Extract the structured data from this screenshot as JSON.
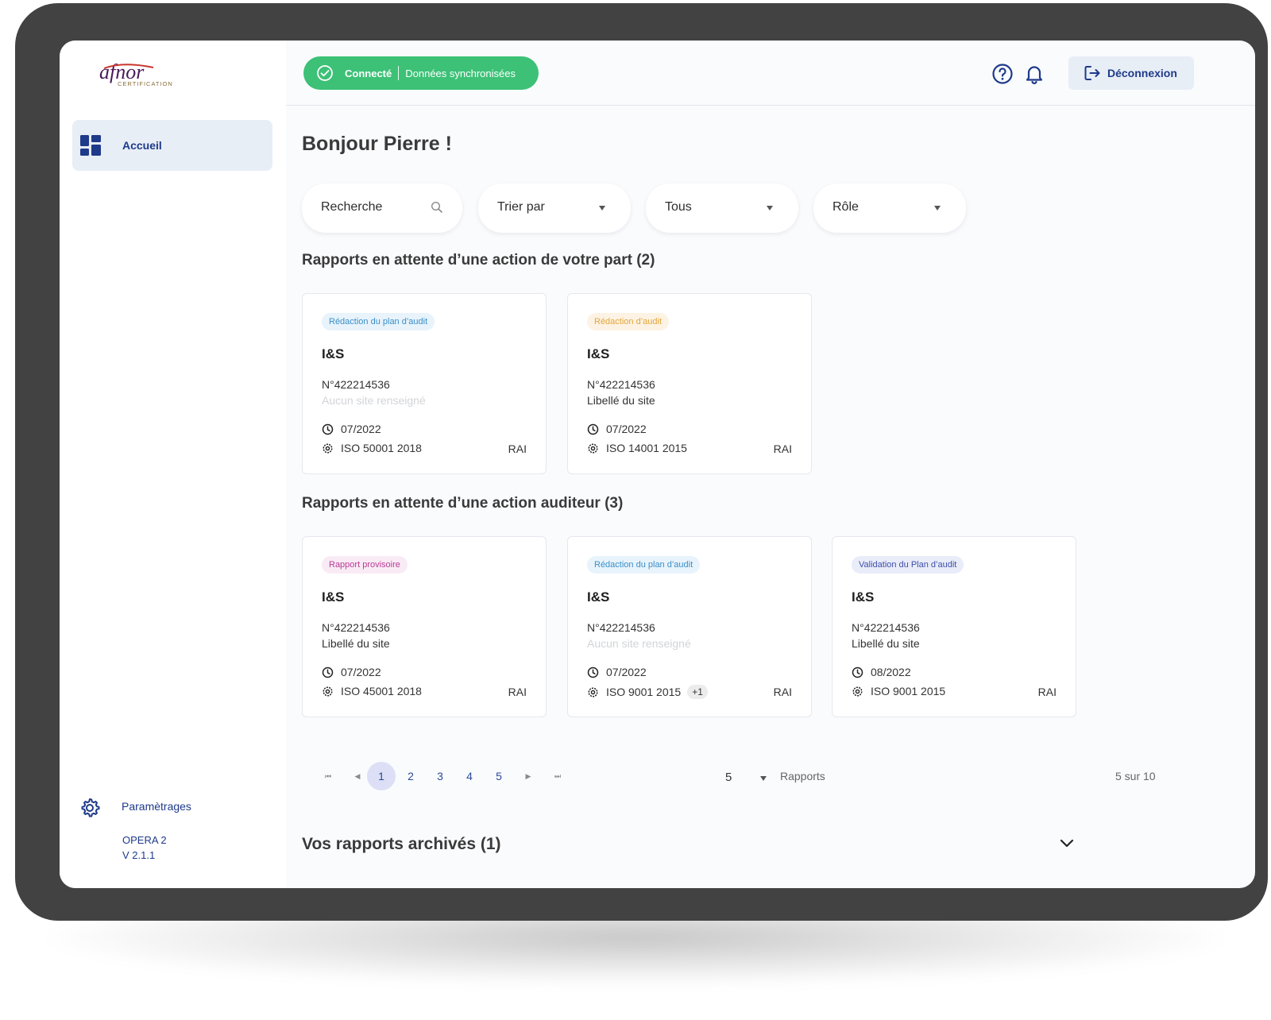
{
  "app": {
    "logo_text": "afnor",
    "logo_subtext": "CERTIFICATION"
  },
  "sidebar": {
    "home_label": "Accueil",
    "settings_label": "Paramètrages",
    "version_name": "OPERA 2",
    "version_number": "V 2.1.1"
  },
  "header": {
    "status_connected": "Connecté",
    "status_sync": "Données synchronisées",
    "logout_label": "Déconnexion",
    "colors": {
      "status": "#3cc176",
      "accent": "#1e3a8a"
    }
  },
  "main": {
    "greeting": "Bonjour Pierre !",
    "search_placeholder": "Recherche",
    "filters": {
      "sort": "Trier par",
      "status": "Tous",
      "role": "Rôle"
    },
    "section_pending_mine": "Rapports en attente d’une action de votre part (2)",
    "section_pending_auditor": "Rapports en attente d’une action auditeur (3)",
    "pending_mine": [
      {
        "badge": "Rédaction du plan d’audit",
        "title": "I&S",
        "number": "N°422214536",
        "site": "Aucun site renseigné",
        "date": "07/2022",
        "standard": "ISO 50001 2018",
        "extra": "",
        "role": "RAI"
      },
      {
        "badge": "Rédaction d’audit",
        "title": "I&S",
        "number": "N°422214536",
        "site": "Libellé du site",
        "date": "07/2022",
        "standard": "ISO 14001 2015",
        "extra": "",
        "role": "RAI"
      }
    ],
    "pending_auditor": [
      {
        "badge": "Rapport provisoire",
        "title": "I&S",
        "number": "N°422214536",
        "site": "Libellé du site",
        "date": "07/2022",
        "standard": "ISO 45001 2018",
        "extra": "",
        "role": "RAI"
      },
      {
        "badge": "Rédaction du plan d’audit",
        "title": "I&S",
        "number": "N°422214536",
        "site": "Aucun site renseigné",
        "date": "07/2022",
        "standard": "ISO 9001 2015",
        "extra": "+1",
        "role": "RAI"
      },
      {
        "badge": "Validation du Plan d’audit",
        "title": "I&S",
        "number": "N°422214536",
        "site": "Libellé du site",
        "date": "08/2022",
        "standard": "ISO 9001 2015",
        "extra": "",
        "role": "RAI"
      }
    ],
    "pagination": {
      "pages": [
        "1",
        "2",
        "3",
        "4",
        "5"
      ],
      "current": "1",
      "per_page": "5",
      "per_page_label": "Rapports",
      "count": "5 sur 10"
    },
    "archived_title": "Vos rapports archivés (1)"
  }
}
